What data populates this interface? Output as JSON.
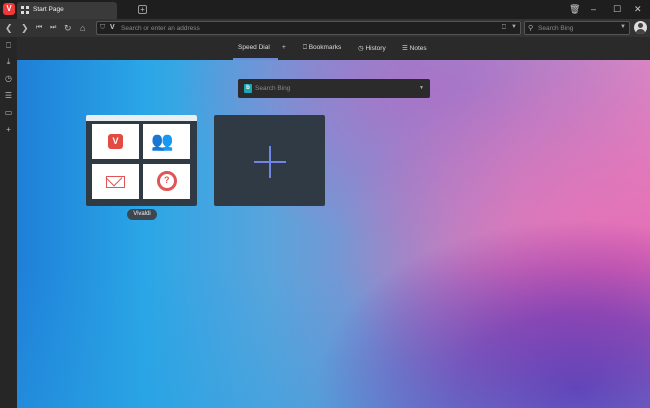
{
  "tab": {
    "title": "Start Page"
  },
  "address": {
    "placeholder": "Search or enter an address"
  },
  "search": {
    "placeholder": "Search Bing"
  },
  "nav": {
    "speed_dial": "Speed Dial",
    "add": "+",
    "bookmarks": "Bookmarks",
    "history": "History",
    "notes": "Notes"
  },
  "page_search": {
    "placeholder": "Search Bing"
  },
  "dial": {
    "label": "Vivaldi"
  },
  "colors": {
    "accent": "#6a8ad6",
    "brand": "#ef3939",
    "bing": "#1aa7b4"
  }
}
